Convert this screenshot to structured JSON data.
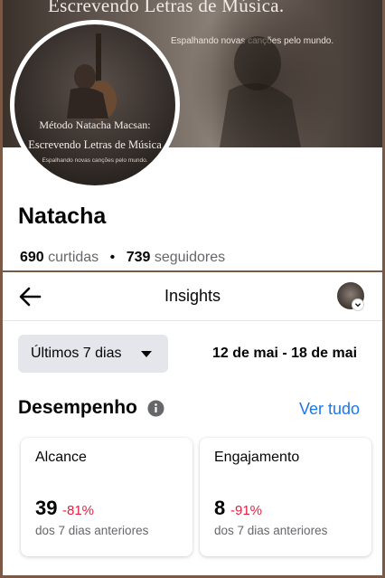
{
  "profile": {
    "cover_title": "Escrevendo Letras de Música.",
    "cover_subtitle": "Espalhando novas canções pelo mundo.",
    "avatar_line1": "Método Natacha Macsan:",
    "avatar_line2": "Escrevendo Letras de Música",
    "avatar_line3": "Espalhando novas canções pelo mundo.",
    "name": "Natacha",
    "likes_count": "690",
    "likes_label": "curtidas",
    "separator": "•",
    "followers_count": "739",
    "followers_label": "seguidores"
  },
  "header": {
    "back_icon": "arrow-left-icon",
    "title": "Insights",
    "avatar_icon": "profile-avatar-chevron-icon"
  },
  "filter": {
    "selected": "Últimos 7 dias",
    "caret_icon": "caret-down-icon",
    "date_range": "12 de mai - 18 de mai"
  },
  "performance": {
    "title": "Desempenho",
    "info_icon": "info-icon",
    "see_all": "Ver tudo",
    "cards": [
      {
        "label": "Alcance",
        "value": "39",
        "change": "-81%",
        "comparison": "dos 7 dias anteriores"
      },
      {
        "label": "Engajamento",
        "value": "8",
        "change": "-91%",
        "comparison": "dos 7 dias anteriores"
      }
    ]
  },
  "colors": {
    "link": "#1877f2",
    "negative": "#e41e3f",
    "frame": "#7a5a44",
    "filter_bg": "#e4e6eb"
  }
}
